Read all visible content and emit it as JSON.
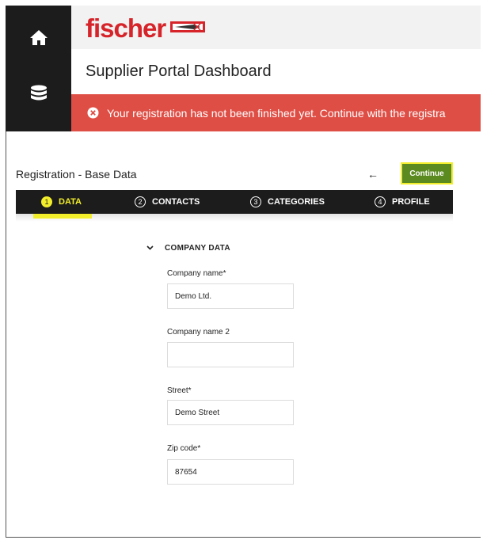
{
  "sidebar": {
    "items": [
      {
        "icon": "home-icon"
      },
      {
        "icon": "database-icon"
      }
    ]
  },
  "header": {
    "logo_text": "fischer",
    "page_title": "Supplier Portal Dashboard"
  },
  "alert": {
    "icon": "error-circle-icon",
    "text": "Your registration has not been finished yet. Continue with the registra",
    "color": "#df4e45"
  },
  "registration": {
    "title": "Registration - Base Data",
    "back_icon": "←",
    "continue_label": "Continue"
  },
  "stepper": {
    "steps": [
      {
        "number": "1",
        "label": "DATA",
        "active": true
      },
      {
        "number": "2",
        "label": "CONTACTS",
        "active": false
      },
      {
        "number": "3",
        "label": "CATEGORIES",
        "active": false
      },
      {
        "number": "4",
        "label": "PROFILE",
        "active": false
      }
    ],
    "accent": "#f2ee2c"
  },
  "form": {
    "section_title": "COMPANY DATA",
    "fields": [
      {
        "label": "Company name*",
        "value": "Demo Ltd."
      },
      {
        "label": "Company name 2",
        "value": ""
      },
      {
        "label": "Street*",
        "value": "Demo Street"
      },
      {
        "label": "Zip code*",
        "value": "87654"
      }
    ]
  }
}
